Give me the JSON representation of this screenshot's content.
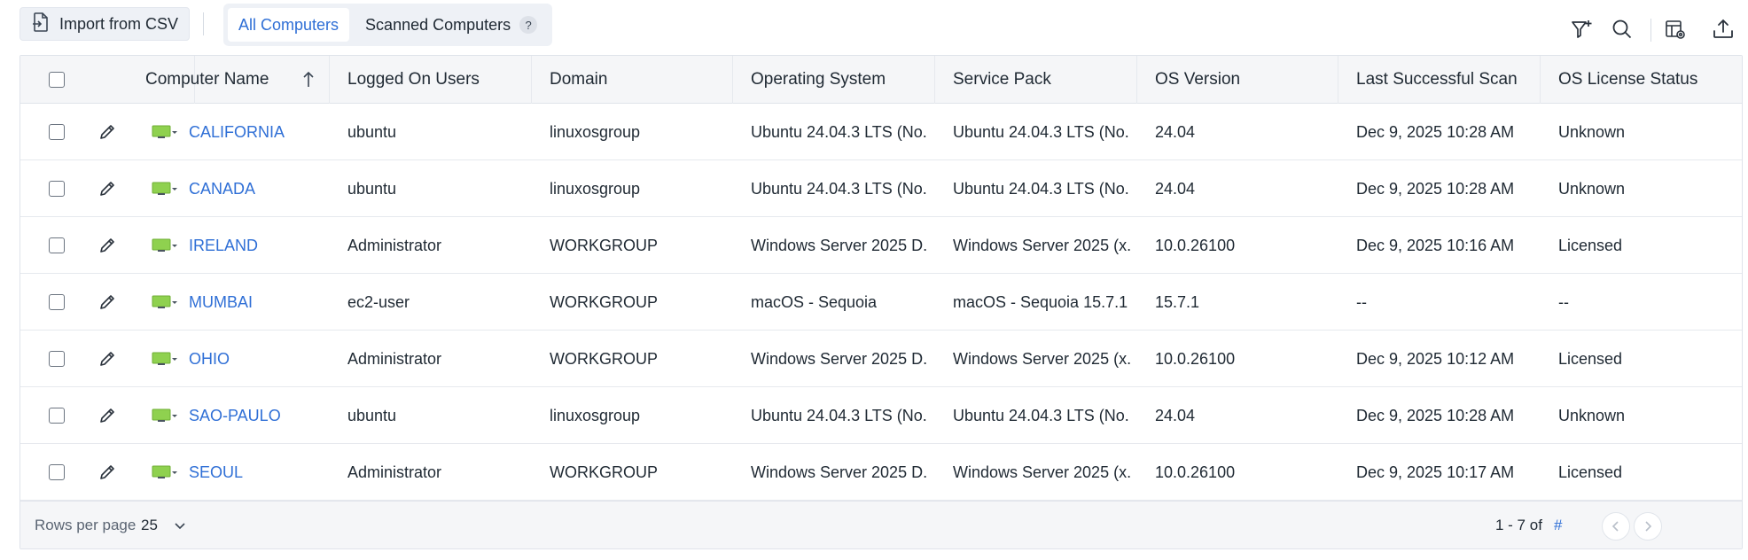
{
  "toolbar": {
    "import_label": "Import from CSV",
    "tabs": [
      {
        "label": "All Computers",
        "active": true
      },
      {
        "label": "Scanned Computers",
        "active": false
      }
    ],
    "help_label": "?",
    "icons": [
      "add-filter-icon",
      "search-icon",
      "column-settings-icon",
      "export-icon"
    ]
  },
  "table": {
    "columns": [
      "Computer Name",
      "Logged On Users",
      "Domain",
      "Operating System",
      "Service Pack",
      "OS Version",
      "Last Successful Scan",
      "OS License Status"
    ],
    "sort": {
      "column": "Computer Name",
      "direction": "ascending"
    },
    "rows": [
      {
        "name": "CALIFORNIA",
        "users": "ubuntu",
        "domain": "linuxosgroup",
        "os": "Ubuntu 24.04.3 LTS (No...",
        "sp": "Ubuntu 24.04.3 LTS (No...",
        "ver": "24.04",
        "scan": "Dec 9, 2025 10:28 AM",
        "license": "Unknown"
      },
      {
        "name": "CANADA",
        "users": "ubuntu",
        "domain": "linuxosgroup",
        "os": "Ubuntu 24.04.3 LTS (No...",
        "sp": "Ubuntu 24.04.3 LTS (No...",
        "ver": "24.04",
        "scan": "Dec 9, 2025 10:28 AM",
        "license": "Unknown"
      },
      {
        "name": "IRELAND",
        "users": "Administrator",
        "domain": "WORKGROUP",
        "os": "Windows Server 2025 D...",
        "sp": "Windows Server 2025 (x...",
        "ver": "10.0.26100",
        "scan": "Dec 9, 2025 10:16 AM",
        "license": "Licensed"
      },
      {
        "name": "MUMBAI",
        "users": "ec2-user",
        "domain": "WORKGROUP",
        "os": "macOS - Sequoia",
        "sp": "macOS - Sequoia 15.7.1",
        "ver": "15.7.1",
        "scan": "--",
        "license": "--"
      },
      {
        "name": "OHIO",
        "users": "Administrator",
        "domain": "WORKGROUP",
        "os": "Windows Server 2025 D...",
        "sp": "Windows Server 2025 (x...",
        "ver": "10.0.26100",
        "scan": "Dec 9, 2025 10:12 AM",
        "license": "Licensed"
      },
      {
        "name": "SAO-PAULO",
        "users": "ubuntu",
        "domain": "linuxosgroup",
        "os": "Ubuntu 24.04.3 LTS (No...",
        "sp": "Ubuntu 24.04.3 LTS (No...",
        "ver": "24.04",
        "scan": "Dec 9, 2025 10:28 AM",
        "license": "Unknown"
      },
      {
        "name": "SEOUL",
        "users": "Administrator",
        "domain": "WORKGROUP",
        "os": "Windows Server 2025 D...",
        "sp": "Windows Server 2025 (x...",
        "ver": "10.0.26100",
        "scan": "Dec 9, 2025 10:17 AM",
        "license": "Licensed"
      }
    ]
  },
  "footer": {
    "rows_per_page_label": "Rows per page",
    "rows_per_page_value": "25",
    "range": "1 - 7 of",
    "total": "#"
  },
  "colors": {
    "accent": "#2f6fd6",
    "computer_icon": "#8fd14f",
    "header_bg": "#f5f6f8"
  }
}
